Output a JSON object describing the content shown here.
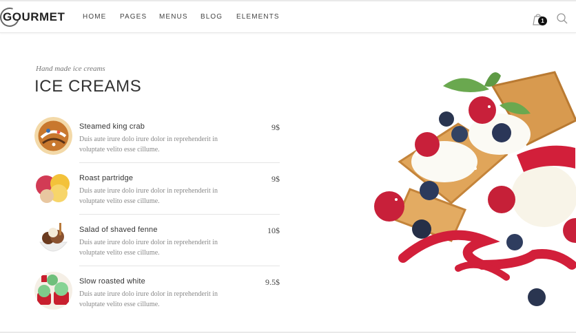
{
  "logo": {
    "text": "GOURMET"
  },
  "nav": {
    "items": [
      {
        "label": "HOME"
      },
      {
        "label": "PAGES"
      },
      {
        "label": "MENUS"
      },
      {
        "label": "BLOG"
      },
      {
        "label": "ELEMENTS"
      }
    ]
  },
  "cart": {
    "count": "1",
    "icon": "shopping-bag-icon"
  },
  "search": {
    "icon": "search-icon"
  },
  "section": {
    "subtitle": "Hand made ice creams",
    "title": "ICE CREAMS"
  },
  "menu": {
    "items": [
      {
        "name": "Steamed king crab",
        "description": "Duis aute irure dolo irure dolor in reprehenderit in voluptate velito esse cillume.",
        "price": "9$"
      },
      {
        "name": "Roast partridge",
        "description": "Duis aute irure dolo irure dolor in reprehenderit in voluptate velito esse cillume.",
        "price": "9$"
      },
      {
        "name": "Salad of shaved fenne",
        "description": "Duis aute irure dolo irure dolor in reprehenderit in voluptate velito esse cillume.",
        "price": "10$"
      },
      {
        "name": "Slow roasted white",
        "description": "Duis aute irure dolo irure dolor in reprehenderit in voluptate velito esse cillume.",
        "price": "9.5$"
      }
    ]
  },
  "colors": {
    "accent": "#d21f3a",
    "text": "#333333",
    "muted": "#888888",
    "badge": "#111111"
  }
}
